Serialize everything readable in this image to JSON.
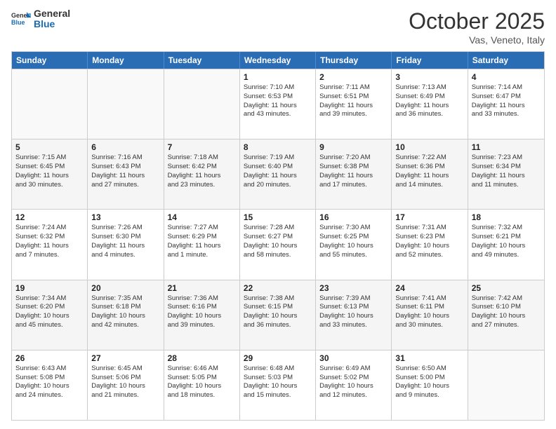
{
  "header": {
    "logo_general": "General",
    "logo_blue": "Blue",
    "month": "October 2025",
    "location": "Vas, Veneto, Italy"
  },
  "weekdays": [
    "Sunday",
    "Monday",
    "Tuesday",
    "Wednesday",
    "Thursday",
    "Friday",
    "Saturday"
  ],
  "rows": [
    [
      {
        "day": "",
        "text": ""
      },
      {
        "day": "",
        "text": ""
      },
      {
        "day": "",
        "text": ""
      },
      {
        "day": "1",
        "text": "Sunrise: 7:10 AM\nSunset: 6:53 PM\nDaylight: 11 hours\nand 43 minutes."
      },
      {
        "day": "2",
        "text": "Sunrise: 7:11 AM\nSunset: 6:51 PM\nDaylight: 11 hours\nand 39 minutes."
      },
      {
        "day": "3",
        "text": "Sunrise: 7:13 AM\nSunset: 6:49 PM\nDaylight: 11 hours\nand 36 minutes."
      },
      {
        "day": "4",
        "text": "Sunrise: 7:14 AM\nSunset: 6:47 PM\nDaylight: 11 hours\nand 33 minutes."
      }
    ],
    [
      {
        "day": "5",
        "text": "Sunrise: 7:15 AM\nSunset: 6:45 PM\nDaylight: 11 hours\nand 30 minutes."
      },
      {
        "day": "6",
        "text": "Sunrise: 7:16 AM\nSunset: 6:43 PM\nDaylight: 11 hours\nand 27 minutes."
      },
      {
        "day": "7",
        "text": "Sunrise: 7:18 AM\nSunset: 6:42 PM\nDaylight: 11 hours\nand 23 minutes."
      },
      {
        "day": "8",
        "text": "Sunrise: 7:19 AM\nSunset: 6:40 PM\nDaylight: 11 hours\nand 20 minutes."
      },
      {
        "day": "9",
        "text": "Sunrise: 7:20 AM\nSunset: 6:38 PM\nDaylight: 11 hours\nand 17 minutes."
      },
      {
        "day": "10",
        "text": "Sunrise: 7:22 AM\nSunset: 6:36 PM\nDaylight: 11 hours\nand 14 minutes."
      },
      {
        "day": "11",
        "text": "Sunrise: 7:23 AM\nSunset: 6:34 PM\nDaylight: 11 hours\nand 11 minutes."
      }
    ],
    [
      {
        "day": "12",
        "text": "Sunrise: 7:24 AM\nSunset: 6:32 PM\nDaylight: 11 hours\nand 7 minutes."
      },
      {
        "day": "13",
        "text": "Sunrise: 7:26 AM\nSunset: 6:30 PM\nDaylight: 11 hours\nand 4 minutes."
      },
      {
        "day": "14",
        "text": "Sunrise: 7:27 AM\nSunset: 6:29 PM\nDaylight: 11 hours\nand 1 minute."
      },
      {
        "day": "15",
        "text": "Sunrise: 7:28 AM\nSunset: 6:27 PM\nDaylight: 10 hours\nand 58 minutes."
      },
      {
        "day": "16",
        "text": "Sunrise: 7:30 AM\nSunset: 6:25 PM\nDaylight: 10 hours\nand 55 minutes."
      },
      {
        "day": "17",
        "text": "Sunrise: 7:31 AM\nSunset: 6:23 PM\nDaylight: 10 hours\nand 52 minutes."
      },
      {
        "day": "18",
        "text": "Sunrise: 7:32 AM\nSunset: 6:21 PM\nDaylight: 10 hours\nand 49 minutes."
      }
    ],
    [
      {
        "day": "19",
        "text": "Sunrise: 7:34 AM\nSunset: 6:20 PM\nDaylight: 10 hours\nand 45 minutes."
      },
      {
        "day": "20",
        "text": "Sunrise: 7:35 AM\nSunset: 6:18 PM\nDaylight: 10 hours\nand 42 minutes."
      },
      {
        "day": "21",
        "text": "Sunrise: 7:36 AM\nSunset: 6:16 PM\nDaylight: 10 hours\nand 39 minutes."
      },
      {
        "day": "22",
        "text": "Sunrise: 7:38 AM\nSunset: 6:15 PM\nDaylight: 10 hours\nand 36 minutes."
      },
      {
        "day": "23",
        "text": "Sunrise: 7:39 AM\nSunset: 6:13 PM\nDaylight: 10 hours\nand 33 minutes."
      },
      {
        "day": "24",
        "text": "Sunrise: 7:41 AM\nSunset: 6:11 PM\nDaylight: 10 hours\nand 30 minutes."
      },
      {
        "day": "25",
        "text": "Sunrise: 7:42 AM\nSunset: 6:10 PM\nDaylight: 10 hours\nand 27 minutes."
      }
    ],
    [
      {
        "day": "26",
        "text": "Sunrise: 6:43 AM\nSunset: 5:08 PM\nDaylight: 10 hours\nand 24 minutes."
      },
      {
        "day": "27",
        "text": "Sunrise: 6:45 AM\nSunset: 5:06 PM\nDaylight: 10 hours\nand 21 minutes."
      },
      {
        "day": "28",
        "text": "Sunrise: 6:46 AM\nSunset: 5:05 PM\nDaylight: 10 hours\nand 18 minutes."
      },
      {
        "day": "29",
        "text": "Sunrise: 6:48 AM\nSunset: 5:03 PM\nDaylight: 10 hours\nand 15 minutes."
      },
      {
        "day": "30",
        "text": "Sunrise: 6:49 AM\nSunset: 5:02 PM\nDaylight: 10 hours\nand 12 minutes."
      },
      {
        "day": "31",
        "text": "Sunrise: 6:50 AM\nSunset: 5:00 PM\nDaylight: 10 hours\nand 9 minutes."
      },
      {
        "day": "",
        "text": ""
      }
    ]
  ]
}
